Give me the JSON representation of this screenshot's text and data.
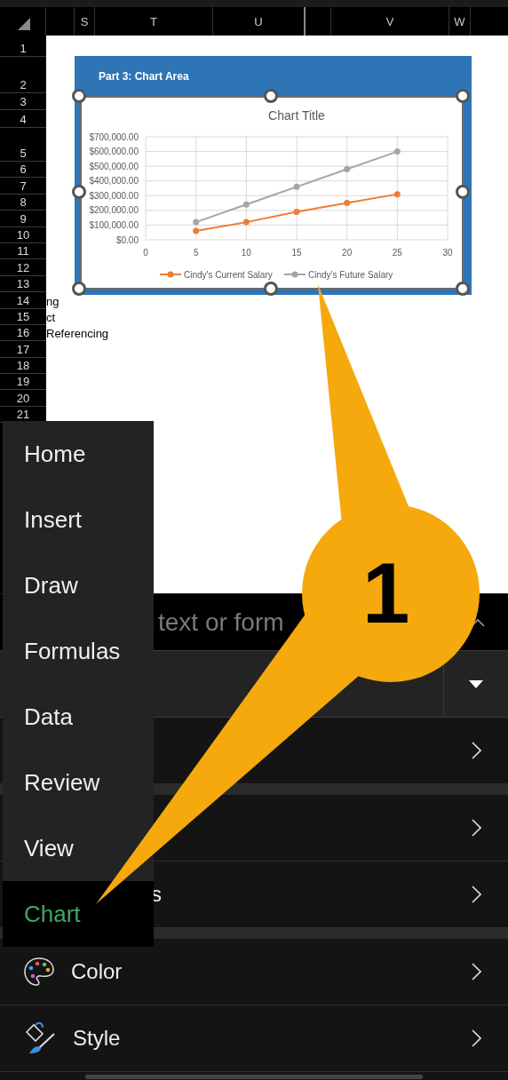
{
  "spreadsheet": {
    "column_headers": [
      "S",
      "T",
      "U",
      "V",
      "W"
    ],
    "rows": [
      {
        "number": "1"
      },
      {
        "number": "2"
      },
      {
        "number": "3"
      },
      {
        "number": "4"
      },
      {
        "number": "5"
      },
      {
        "number": "6"
      },
      {
        "number": "7"
      },
      {
        "number": "8"
      },
      {
        "number": "9"
      },
      {
        "number": "10"
      },
      {
        "number": "11"
      },
      {
        "number": "12"
      },
      {
        "number": "13"
      },
      {
        "number": "14",
        "text": "ng"
      },
      {
        "number": "15",
        "text": "ct"
      },
      {
        "number": "16",
        "text": "Referencing"
      },
      {
        "number": "17"
      },
      {
        "number": "18"
      },
      {
        "number": "19"
      },
      {
        "number": "20"
      },
      {
        "number": "21"
      }
    ]
  },
  "chart_object": {
    "header": "Part 3: Chart Area",
    "selected": true,
    "chart_data": {
      "type": "line",
      "title": "Chart Title",
      "x": [
        5,
        10,
        15,
        20,
        25
      ],
      "grid": true,
      "legend": true,
      "series": [
        {
          "name": "Cindy's Current Salary",
          "color": "#ed7d31",
          "marker": "circle",
          "values": [
            60000,
            120000,
            190000,
            250000,
            310000
          ]
        },
        {
          "name": "Cindy's Future Salary",
          "color": "#a5a5a5",
          "marker": "circle",
          "values": [
            120000,
            240000,
            360000,
            480000,
            600000
          ]
        }
      ],
      "xlim": [
        0,
        30
      ],
      "ylim": [
        0,
        700000
      ],
      "xticks": [
        0,
        5,
        10,
        15,
        20,
        25,
        30
      ],
      "yticks": [
        {
          "value": 0,
          "label": "$0.00"
        },
        {
          "value": 100000,
          "label": "$100,000.00"
        },
        {
          "value": 200000,
          "label": "$200,000.00"
        },
        {
          "value": 300000,
          "label": "$300,000.00"
        },
        {
          "value": 400000,
          "label": "$400,000.00"
        },
        {
          "value": 500000,
          "label": "$500,000.00"
        },
        {
          "value": 600000,
          "label": "$600,000.00"
        },
        {
          "value": 700000,
          "label": "$700,000.00"
        }
      ]
    }
  },
  "formula_bar": {
    "placeholder": "text or form"
  },
  "panel_groups": [
    {
      "rows": [
        {
          "kind": "blank"
        }
      ]
    },
    {
      "rows": [
        {
          "kind": "blank"
        },
        {
          "kind": "text",
          "label": "s"
        }
      ]
    },
    {
      "rows": [
        {
          "kind": "palette",
          "label": "Color"
        },
        {
          "kind": "brush",
          "label": "Style"
        }
      ]
    }
  ],
  "menu": {
    "items": [
      {
        "label": "Home",
        "selected": false
      },
      {
        "label": "Insert",
        "selected": false
      },
      {
        "label": "Draw",
        "selected": false
      },
      {
        "label": "Formulas",
        "selected": false
      },
      {
        "label": "Data",
        "selected": false
      },
      {
        "label": "Review",
        "selected": false
      },
      {
        "label": "View",
        "selected": false
      },
      {
        "label": "Chart",
        "selected": true
      }
    ]
  },
  "callout": {
    "label": "1"
  }
}
